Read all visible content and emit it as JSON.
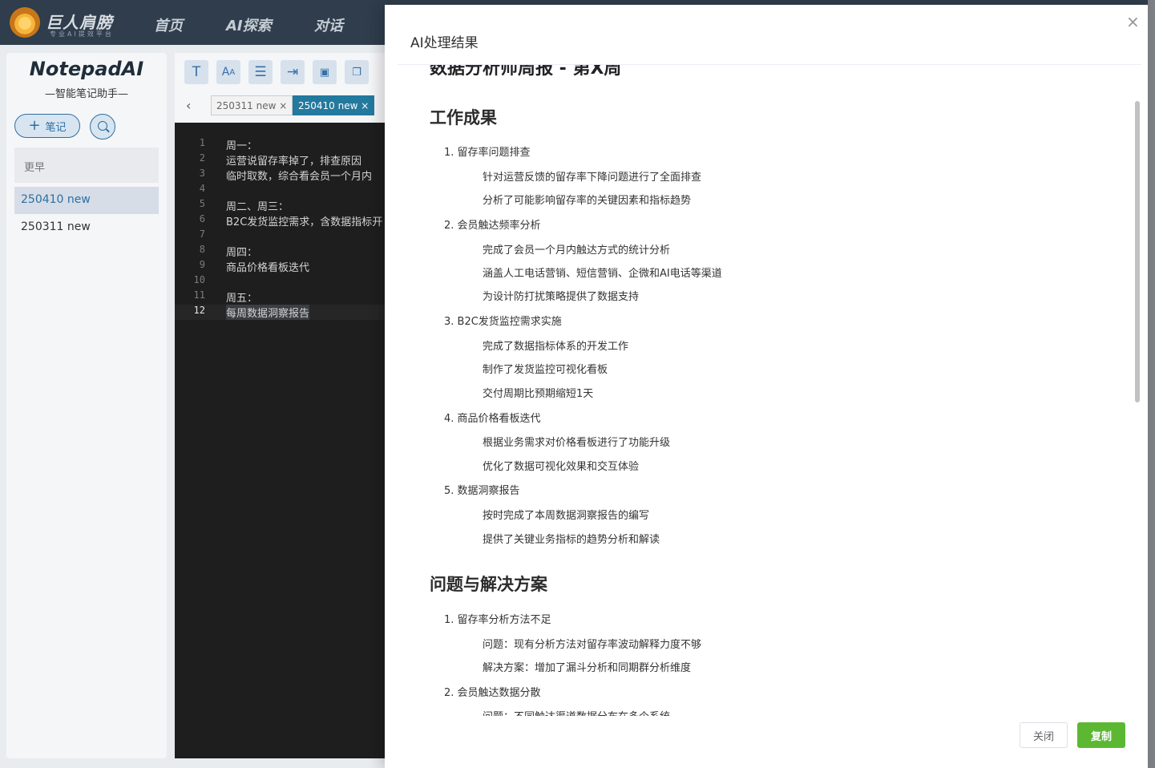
{
  "app": {
    "logo_title": "巨人肩膀",
    "logo_subtitle": "专业AI提效平台",
    "nav": [
      "首页",
      "AI探索",
      "对话"
    ]
  },
  "sidebar": {
    "brand_title": "NotepadAI",
    "brand_subtitle": "—智能笔记助手—",
    "add_note_label": "笔记",
    "group_label": "更早",
    "notes": [
      "250410 new",
      "250311 new"
    ]
  },
  "editor": {
    "toolbar_icons": [
      "text-icon",
      "font-size-icon",
      "wrap-icon",
      "indent-icon",
      "save-icon",
      "copy-icon"
    ],
    "tabs": [
      "250311 new ×",
      "250410 new ×"
    ],
    "lines": [
      {
        "n": "1",
        "t": "周一："
      },
      {
        "n": "2",
        "t": "运营说留存率掉了，排查原因"
      },
      {
        "n": "3",
        "t": "临时取数，综合看会员一个月内"
      },
      {
        "n": "4",
        "t": ""
      },
      {
        "n": "5",
        "t": "周二、周三："
      },
      {
        "n": "6",
        "t": "B2C发货监控需求，含数据指标开"
      },
      {
        "n": "7",
        "t": ""
      },
      {
        "n": "8",
        "t": "周四："
      },
      {
        "n": "9",
        "t": "商品价格看板迭代"
      },
      {
        "n": "10",
        "t": ""
      },
      {
        "n": "11",
        "t": "周五："
      },
      {
        "n": "12",
        "t": "每周数据洞察报告"
      }
    ]
  },
  "drawer": {
    "title": "AI处理结果",
    "close_icon": "×",
    "partial_heading": "数据分析师周报 - 第X周",
    "sections": [
      {
        "heading": "工作成果",
        "items": [
          {
            "title": "1. 留存率问题排查",
            "subs": [
              "针对运营反馈的留存率下降问题进行了全面排查",
              "分析了可能影响留存率的关键因素和指标趋势"
            ]
          },
          {
            "title": "2. 会员触达频率分析",
            "subs": [
              "完成了会员一个月内触达方式的统计分析",
              "涵盖人工电话营销、短信营销、企微和AI电话等渠道",
              "为设计防打扰策略提供了数据支持"
            ]
          },
          {
            "title": "3. B2C发货监控需求实施",
            "subs": [
              "完成了数据指标体系的开发工作",
              "制作了发货监控可视化看板",
              "交付周期比预期缩短1天"
            ]
          },
          {
            "title": "4. 商品价格看板迭代",
            "subs": [
              "根据业务需求对价格看板进行了功能升级",
              "优化了数据可视化效果和交互体验"
            ]
          },
          {
            "title": "5. 数据洞察报告",
            "subs": [
              "按时完成了本周数据洞察报告的编写",
              "提供了关键业务指标的趋势分析和解读"
            ]
          }
        ]
      },
      {
        "heading": "问题与解决方案",
        "items": [
          {
            "title": "1. 留存率分析方法不足",
            "subs": [
              "问题：现有分析方法对留存率波动解释力度不够",
              "解决方案：增加了漏斗分析和同期群分析维度"
            ]
          },
          {
            "title": "2. 会员触达数据分散",
            "subs": [
              "问题：不同触达渠道数据分布在多个系统"
            ]
          }
        ]
      }
    ],
    "close_button": "关闭",
    "copy_button": "复制"
  }
}
